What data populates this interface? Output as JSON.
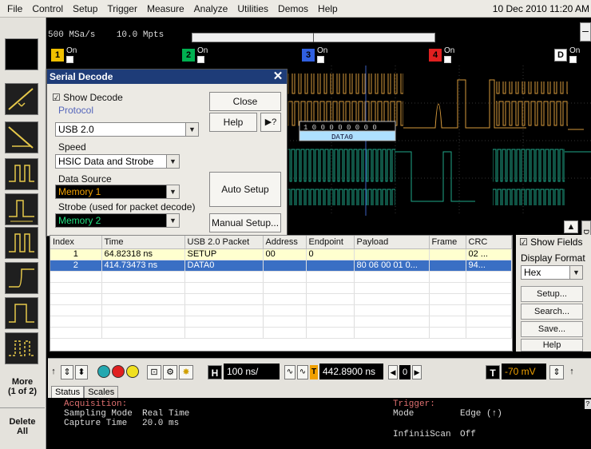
{
  "menu": {
    "items": [
      "File",
      "Control",
      "Setup",
      "Trigger",
      "Measure",
      "Analyze",
      "Utilities",
      "Demos",
      "Help"
    ],
    "datetime": "10 Dec 2010 11:20 AM"
  },
  "acquisition_header": {
    "sample_rate": "500 MSa/s",
    "memory_depth": "10.0 Mpts"
  },
  "channels": [
    {
      "num": "1",
      "state": "On",
      "color": "#f0c000"
    },
    {
      "num": "2",
      "state": "On",
      "color": "#00b050"
    },
    {
      "num": "3",
      "state": "On",
      "color": "#3060e0"
    },
    {
      "num": "4",
      "state": "On",
      "color": "#e02020"
    },
    {
      "num": "D",
      "state": "On",
      "color": "#ffffff"
    }
  ],
  "dialog": {
    "title": "Serial Decode",
    "show_decode": "Show Decode",
    "protocol_group": "Protocol",
    "protocol_value": "USB 2.0",
    "speed_label": "Speed",
    "speed_value": "HSIC Data and Strobe",
    "data_source_label": "Data Source",
    "data_source_value": "Memory 1",
    "strobe_label": "Strobe (used for packet decode)",
    "strobe_value": "Memory 2",
    "close_btn": "Close",
    "help_btn": "Help",
    "auto_setup_btn": "Auto Setup",
    "manual_setup_btn": "Manual Setup...",
    "data_source_color": "#f0a000",
    "strobe_color": "#20e080"
  },
  "waveform": {
    "decode_packet_label": "DATA0",
    "decode_bits": "1 0 0 0 0 0 0 0 0"
  },
  "table": {
    "columns": [
      "Index",
      "Time",
      "USB 2.0 Packet",
      "Address",
      "Endpoint",
      "Payload",
      "Frame",
      "CRC"
    ],
    "rows": [
      [
        "1",
        "64.82318 ns",
        "SETUP",
        "00",
        "0",
        "",
        "",
        "02 ..."
      ],
      [
        "2",
        "414.73473 ns",
        "DATA0",
        "",
        "",
        "80 06 00 01 0...",
        "",
        "94..."
      ]
    ]
  },
  "fields_panel": {
    "show_fields": "Show Fields",
    "display_format_label": "Display Format",
    "display_format_value": "Hex",
    "setup_btn": "Setup...",
    "search_btn": "Search...",
    "save_btn": "Save...",
    "help_btn": "Help",
    "side_tab": "Decode"
  },
  "control_bar": {
    "timebase": "100 ns/",
    "trigger_pos": "442.8900 ns",
    "zoom_value": "0",
    "trigger_level": "-70 mV",
    "h_label": "H",
    "t_label": "T"
  },
  "left_strip": {
    "more_btn": "More\n(1 of 2)",
    "delete_btn": "Delete\nAll"
  },
  "status_tabs": [
    "Status",
    "Scales"
  ],
  "status": {
    "acq_title": "Acquisition:",
    "sampling_mode_label": "Sampling Mode",
    "sampling_mode_value": "Real Time",
    "capture_time_label": "Capture Time",
    "capture_time_value": "20.0 ms",
    "trigger_title": "Trigger:",
    "mode_label": "Mode",
    "mode_value": "Edge (↑)",
    "infiniiscan_label": "InfiniiScan",
    "infiniiscan_value": "Off",
    "title_color": "#e07070"
  }
}
